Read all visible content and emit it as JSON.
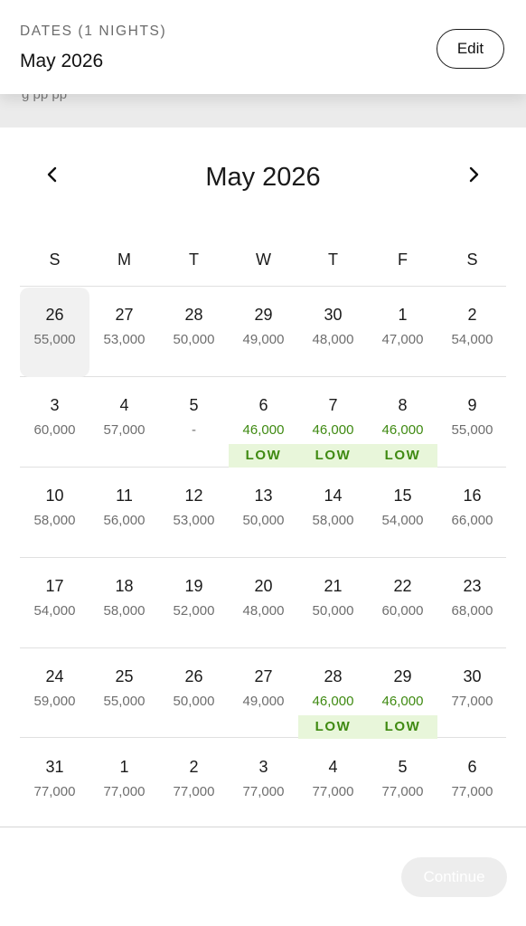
{
  "header": {
    "dates_label": "DATES (1 NIGHTS)",
    "month": "May 2026",
    "edit_label": "Edit"
  },
  "strip_text": "g                              pp              pp",
  "calendar": {
    "title": "May 2026",
    "weekdays": [
      "S",
      "M",
      "T",
      "W",
      "T",
      "F",
      "S"
    ],
    "low_label": "LOW",
    "weeks": [
      [
        {
          "day": "26",
          "price": "55,000",
          "selected": true
        },
        {
          "day": "27",
          "price": "53,000"
        },
        {
          "day": "28",
          "price": "50,000"
        },
        {
          "day": "29",
          "price": "49,000"
        },
        {
          "day": "30",
          "price": "48,000"
        },
        {
          "day": "1",
          "price": "47,000"
        },
        {
          "day": "2",
          "price": "54,000"
        }
      ],
      [
        {
          "day": "3",
          "price": "60,000"
        },
        {
          "day": "4",
          "price": "57,000"
        },
        {
          "day": "5",
          "price": "-"
        },
        {
          "day": "6",
          "price": "46,000",
          "low": true
        },
        {
          "day": "7",
          "price": "46,000",
          "low": true
        },
        {
          "day": "8",
          "price": "46,000",
          "low": true
        },
        {
          "day": "9",
          "price": "55,000"
        }
      ],
      [
        {
          "day": "10",
          "price": "58,000"
        },
        {
          "day": "11",
          "price": "56,000"
        },
        {
          "day": "12",
          "price": "53,000"
        },
        {
          "day": "13",
          "price": "50,000"
        },
        {
          "day": "14",
          "price": "58,000"
        },
        {
          "day": "15",
          "price": "54,000"
        },
        {
          "day": "16",
          "price": "66,000"
        }
      ],
      [
        {
          "day": "17",
          "price": "54,000"
        },
        {
          "day": "18",
          "price": "58,000"
        },
        {
          "day": "19",
          "price": "52,000"
        },
        {
          "day": "20",
          "price": "48,000"
        },
        {
          "day": "21",
          "price": "50,000"
        },
        {
          "day": "22",
          "price": "60,000"
        },
        {
          "day": "23",
          "price": "68,000"
        }
      ],
      [
        {
          "day": "24",
          "price": "59,000"
        },
        {
          "day": "25",
          "price": "55,000"
        },
        {
          "day": "26",
          "price": "50,000"
        },
        {
          "day": "27",
          "price": "49,000"
        },
        {
          "day": "28",
          "price": "46,000",
          "low": true
        },
        {
          "day": "29",
          "price": "46,000",
          "low": true
        },
        {
          "day": "30",
          "price": "77,000"
        }
      ],
      [
        {
          "day": "31",
          "price": "77,000"
        },
        {
          "day": "1",
          "price": "77,000"
        },
        {
          "day": "2",
          "price": "77,000"
        },
        {
          "day": "3",
          "price": "77,000"
        },
        {
          "day": "4",
          "price": "77,000"
        },
        {
          "day": "5",
          "price": "77,000"
        },
        {
          "day": "6",
          "price": "77,000"
        }
      ]
    ]
  },
  "footer": {
    "continue_label": "Continue"
  },
  "icons": {
    "prev": "chevron-left-icon",
    "next": "chevron-right-icon"
  },
  "colors": {
    "low_text": "#3f8a12",
    "low_bg": "#e8f6da",
    "selected_bg": "#f1f1f1"
  }
}
